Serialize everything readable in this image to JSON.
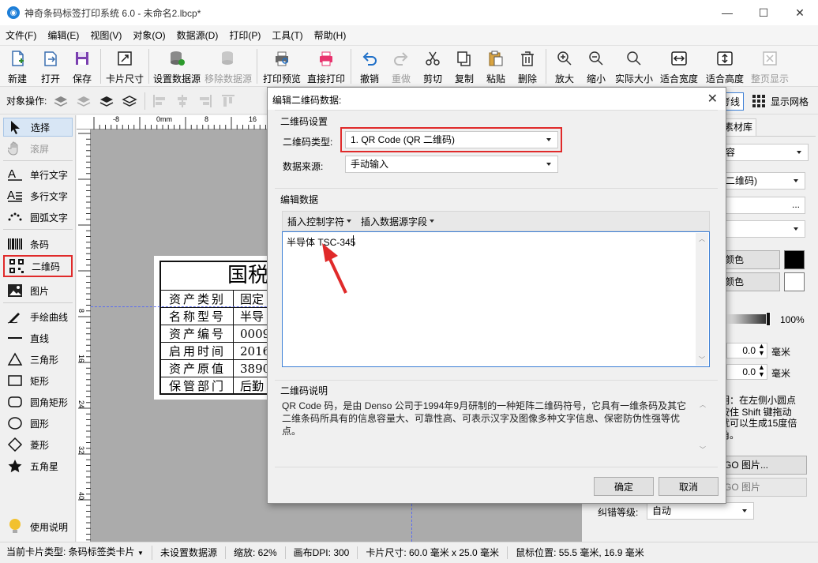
{
  "window": {
    "title": "神奇条码标签打印系统 6.0 - 未命名2.lbcp*",
    "icon": "app-logo-icon"
  },
  "menu": [
    "文件(F)",
    "编辑(E)",
    "视图(V)",
    "对象(O)",
    "数据源(D)",
    "打印(P)",
    "工具(T)",
    "帮助(H)"
  ],
  "toolbar": [
    {
      "label": "新建",
      "icon": "new-file-icon"
    },
    {
      "label": "打开",
      "icon": "open-icon"
    },
    {
      "label": "保存",
      "icon": "save-icon"
    },
    {
      "label": "卡片尺寸",
      "icon": "card-size-icon"
    },
    {
      "label": "设置数据源",
      "icon": "database-icon"
    },
    {
      "label": "移除数据源",
      "icon": "database-remove-icon"
    },
    {
      "label": "打印预览",
      "icon": "print-preview-icon"
    },
    {
      "label": "直接打印",
      "icon": "printer-icon"
    },
    {
      "label": "撤销",
      "icon": "undo-icon"
    },
    {
      "label": "重做",
      "icon": "redo-icon"
    },
    {
      "label": "剪切",
      "icon": "scissors-icon"
    },
    {
      "label": "复制",
      "icon": "copy-icon"
    },
    {
      "label": "粘贴",
      "icon": "paste-icon"
    },
    {
      "label": "删除",
      "icon": "trash-icon"
    },
    {
      "label": "放大",
      "icon": "zoom-in-icon"
    },
    {
      "label": "缩小",
      "icon": "zoom-out-icon"
    },
    {
      "label": "实际大小",
      "icon": "actual-size-icon"
    },
    {
      "label": "适合宽度",
      "icon": "fit-width-icon"
    },
    {
      "label": "适合高度",
      "icon": "fit-height-icon"
    },
    {
      "label": "整页显示",
      "icon": "full-page-icon"
    }
  ],
  "objbar": {
    "label": "对象操作:",
    "ref_line": "考线",
    "grid": "显示网格"
  },
  "palette": [
    {
      "label": "选择",
      "icon": "cursor-icon"
    },
    {
      "label": "滚屏",
      "icon": "hand-icon"
    },
    {
      "label": "单行文字",
      "icon": "single-line-text-icon"
    },
    {
      "label": "多行文字",
      "icon": "multi-line-text-icon"
    },
    {
      "label": "圆弧文字",
      "icon": "arc-text-icon"
    },
    {
      "label": "条码",
      "icon": "barcode-icon"
    },
    {
      "label": "二维码",
      "icon": "qrcode-icon"
    },
    {
      "label": "图片",
      "icon": "image-icon"
    },
    {
      "label": "手绘曲线",
      "icon": "pen-icon"
    },
    {
      "label": "直线",
      "icon": "line-icon"
    },
    {
      "label": "三角形",
      "icon": "triangle-icon"
    },
    {
      "label": "矩形",
      "icon": "rectangle-icon"
    },
    {
      "label": "圆角矩形",
      "icon": "rounded-rect-icon"
    },
    {
      "label": "圆形",
      "icon": "circle-icon"
    },
    {
      "label": "菱形",
      "icon": "diamond-icon"
    },
    {
      "label": "五角星",
      "icon": "star-icon"
    },
    {
      "label": "使用说明",
      "icon": "lightbulb-icon"
    }
  ],
  "rulers": {
    "h": [
      "-8",
      "0mm",
      "8",
      "16"
    ],
    "v": [
      "8",
      "16",
      "24",
      "32",
      "40"
    ]
  },
  "card": {
    "title": "国税",
    "rows": [
      [
        "资产类别",
        "固定"
      ],
      [
        "名称型号",
        "半导"
      ],
      [
        "资产编号",
        "0009"
      ],
      [
        "启用时间",
        "2016"
      ],
      [
        "资产原值",
        "3890"
      ],
      [
        "保管部门",
        "后勤"
      ]
    ]
  },
  "rpanel": {
    "tab_material": "素材库",
    "combo1": "容",
    "combo2": "二维码)",
    "dots": "...",
    "color1": "颜色",
    "color2": "颜色",
    "opacity": "100%",
    "x_val": "0.0",
    "y_val": "0.0",
    "unit": "毫米",
    "hint": "明：在左侧小圆点\n按住 Shift 键拖动\n就可以生成15度倍\n角。",
    "logo_btn1": "GO 图片...",
    "logo_btn2": "GO 图片",
    "ecc_label": "纠错等级:",
    "ecc_value": "自动"
  },
  "status": {
    "card_type": "当前卡片类型:  条码标签类卡片",
    "datasource": "未设置数据源",
    "zoom": "缩放:  62%",
    "dpi": "画布DPI:  300",
    "card_size": "卡片尺寸:  60.0 毫米 x 25.0 毫米",
    "mouse": "鼠标位置:  55.5 毫米,  16.9 毫米"
  },
  "dialog": {
    "title": "编辑二维码数据:",
    "group_settings": "二维码设置",
    "type_label": "二维码类型:",
    "type_value": "1. QR Code (QR 二维码)",
    "source_label": "数据来源:",
    "source_value": "手动输入",
    "group_edit": "编辑数据",
    "insert_ctrl": "插入控制字符",
    "insert_field": "插入数据源字段",
    "data_value": "半导体 TSC-345",
    "group_desc": "二维码说明",
    "desc_text": "QR Code 码，是由 Denso 公司于1994年9月研制的一种矩阵二维码符号，它具有一维条码及其它二维条码所具有的信息容量大、可靠性高、可表示汉字及图像多种文字信息、保密防伪性强等优点。",
    "ok": "确定",
    "cancel": "取消"
  },
  "colors": {
    "highlight": "#e02a2a",
    "arrow": "#e02a2a",
    "focus": "#3c7fd6"
  }
}
